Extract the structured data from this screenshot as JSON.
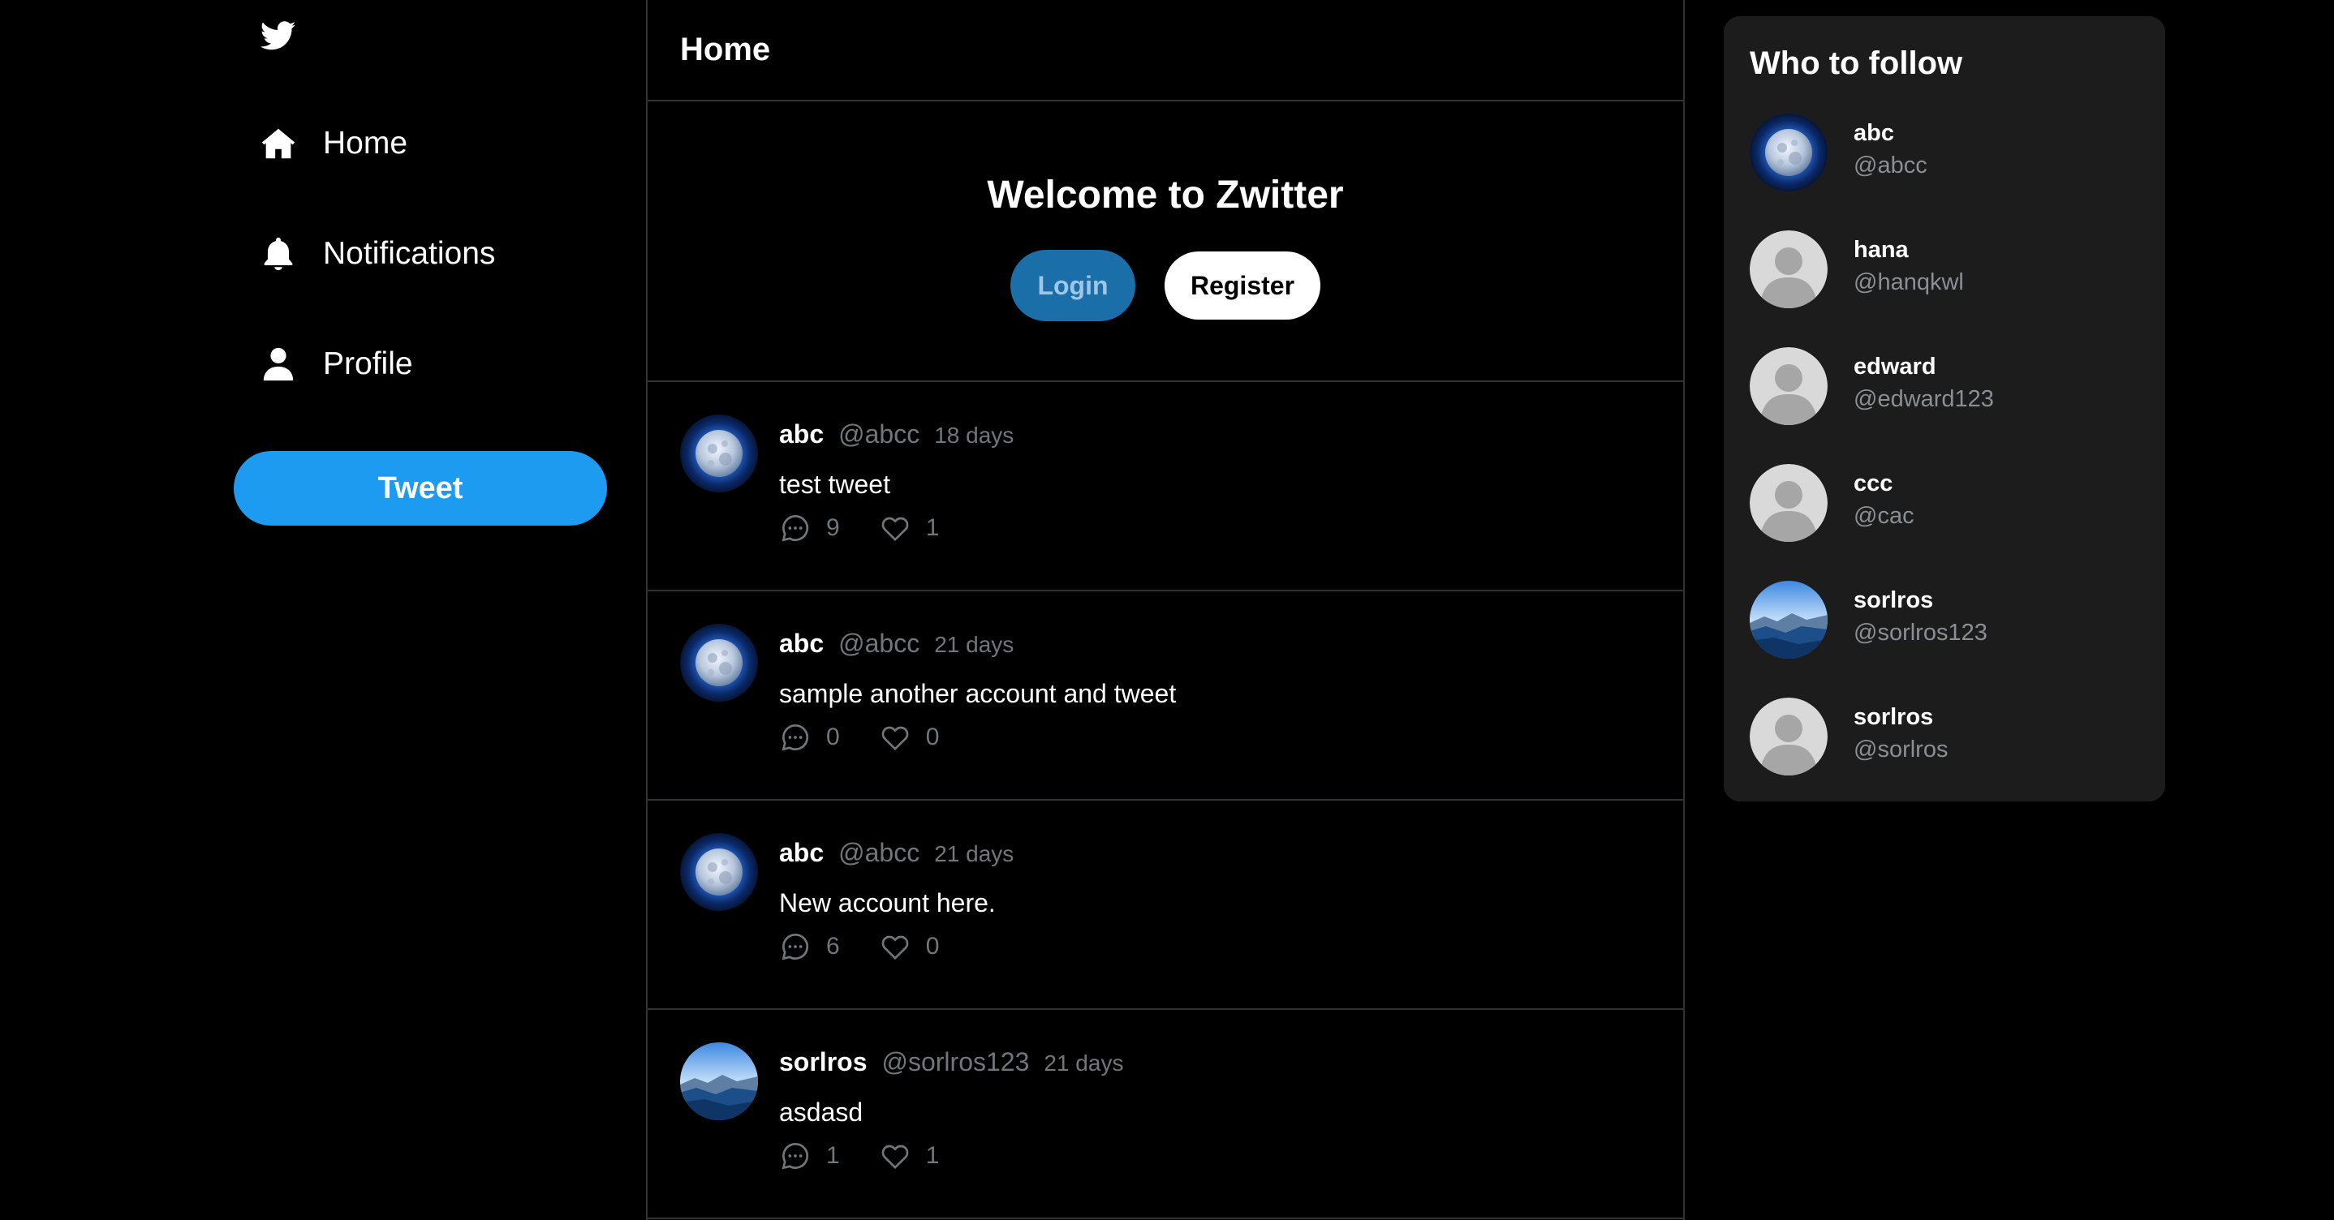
{
  "nav": {
    "logo_icon": "bird-icon",
    "items": [
      {
        "label": "Home",
        "icon": "home-icon"
      },
      {
        "label": "Notifications",
        "icon": "bell-icon"
      },
      {
        "label": "Profile",
        "icon": "user-icon"
      }
    ],
    "tweet_button": "Tweet"
  },
  "main": {
    "title": "Home",
    "welcome": {
      "heading": "Welcome to Zwitter",
      "login_label": "Login",
      "register_label": "Register"
    },
    "tweets": [
      {
        "name": "abc",
        "handle": "@abcc",
        "time": "18 days",
        "text": "test tweet",
        "replies": "9",
        "likes": "1",
        "avatar": "moon"
      },
      {
        "name": "abc",
        "handle": "@abcc",
        "time": "21 days",
        "text": "sample another account and tweet",
        "replies": "0",
        "likes": "0",
        "avatar": "moon"
      },
      {
        "name": "abc",
        "handle": "@abcc",
        "time": "21 days",
        "text": "New account here.",
        "replies": "6",
        "likes": "0",
        "avatar": "moon"
      },
      {
        "name": "sorlros",
        "handle": "@sorlros123",
        "time": "21 days",
        "text": "asdasd",
        "replies": "1",
        "likes": "1",
        "avatar": "landscape"
      }
    ]
  },
  "who_to_follow": {
    "title": "Who to follow",
    "users": [
      {
        "name": "abc",
        "handle": "@abcc",
        "avatar": "moon"
      },
      {
        "name": "hana",
        "handle": "@hanqkwl",
        "avatar": "default"
      },
      {
        "name": "edward",
        "handle": "@edward123",
        "avatar": "default"
      },
      {
        "name": "ccc",
        "handle": "@cac",
        "avatar": "default"
      },
      {
        "name": "sorlros",
        "handle": "@sorlros123",
        "avatar": "landscape"
      },
      {
        "name": "sorlros",
        "handle": "@sorlros",
        "avatar": "default"
      }
    ]
  },
  "colors": {
    "accent": "#1d9bf0",
    "login_button": "#1a6fa8",
    "panel_background": "#1c1c1c",
    "muted_text": "#71767b"
  }
}
